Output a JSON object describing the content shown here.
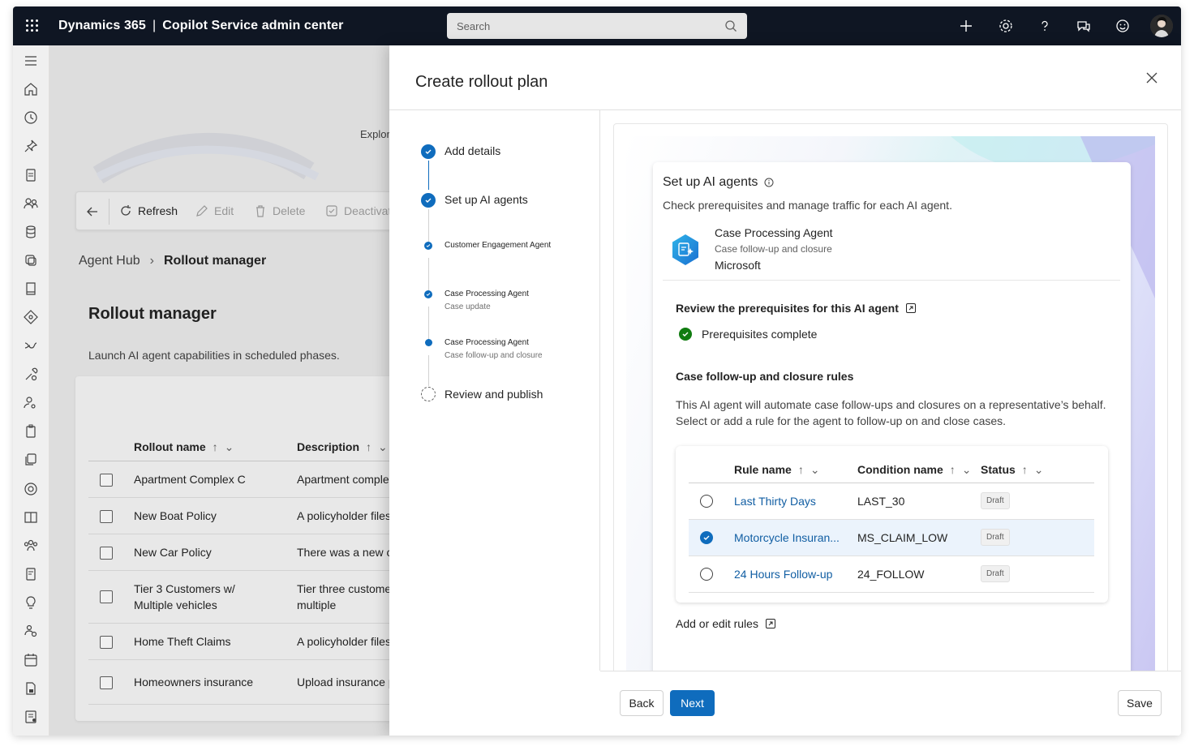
{
  "app": {
    "brand": "Dynamics 365",
    "product": "Copilot Service admin center"
  },
  "search": {
    "placeholder": "Search"
  },
  "background": {
    "explore_text": "Explor",
    "toolbar": {
      "refresh": "Refresh",
      "edit": "Edit",
      "delete": "Delete",
      "deactivate": "Deactivat"
    },
    "breadcrumb": {
      "root": "Agent Hub",
      "current": "Rollout manager"
    },
    "page_title": "Rollout manager",
    "page_description": "Launch AI agent capabilities in scheduled phases.",
    "table": {
      "headers": [
        "Rollout name",
        "Description"
      ],
      "rows": [
        {
          "name": "Apartment Complex C",
          "desc": "Apartment comple"
        },
        {
          "name": "New Boat Policy",
          "desc": "A policyholder files"
        },
        {
          "name": "New Car Policy",
          "desc": "There was a new c"
        },
        {
          "name": "Tier 3 Customers w/ Multiple vehicles",
          "desc": "Tier three custome multiple"
        },
        {
          "name": "Home Theft Claims",
          "desc": "A policyholder files"
        },
        {
          "name": "Homeowners insurance",
          "desc": "Upload insurance p"
        }
      ]
    }
  },
  "panel": {
    "title": "Create rollout plan",
    "steps": [
      {
        "label": "Add details",
        "sub": "",
        "state": "done",
        "size": "main"
      },
      {
        "label": "Set up AI agents",
        "sub": "",
        "state": "done",
        "size": "main"
      },
      {
        "label": "Customer Engagement Agent",
        "sub": "",
        "state": "done",
        "size": "sub"
      },
      {
        "label": "Case Processing Agent",
        "sub": "Case update",
        "state": "done",
        "size": "sub"
      },
      {
        "label": "Case Processing Agent",
        "sub": "Case follow-up and closure",
        "state": "current",
        "size": "sub"
      },
      {
        "label": "Review and publish",
        "sub": "",
        "state": "pending",
        "size": "main"
      }
    ],
    "card": {
      "title": "Set up AI agents",
      "subtitle": "Check prerequisites and manage traffic for each AI agent.",
      "agent": {
        "name": "Case Processing Agent",
        "capability": "Case follow-up and closure",
        "publisher": "Microsoft"
      },
      "prereq_heading": "Review the prerequisites for this AI agent",
      "prereq_status": "Prerequisites complete",
      "rules_heading": "Case follow-up and closure rules",
      "rules_desc_1": "This AI agent will automate case follow-ups and closures on a representative’s behalf.",
      "rules_desc_2": "Select or add a rule for the agent to follow-up on and close cases.",
      "rules_table": {
        "headers": [
          "Rule name",
          "Condition name",
          "Status"
        ],
        "rows": [
          {
            "rule": "Last Thirty Days",
            "condition": "LAST_30",
            "status": "Draft",
            "selected": false
          },
          {
            "rule": "Motorcycle Insuran...",
            "condition": "MS_CLAIM_LOW",
            "status": "Draft",
            "selected": true
          },
          {
            "rule": "24 Hours Follow-up",
            "condition": "24_FOLLOW",
            "status": "Draft",
            "selected": false
          }
        ]
      },
      "add_edit_link": "Add or edit rules"
    },
    "footer": {
      "back": "Back",
      "next": "Next",
      "save": "Save"
    }
  },
  "colors": {
    "accent": "#0f6cbd",
    "topbar": "#0f1623",
    "success": "#107c10",
    "link": "#115ea3"
  }
}
